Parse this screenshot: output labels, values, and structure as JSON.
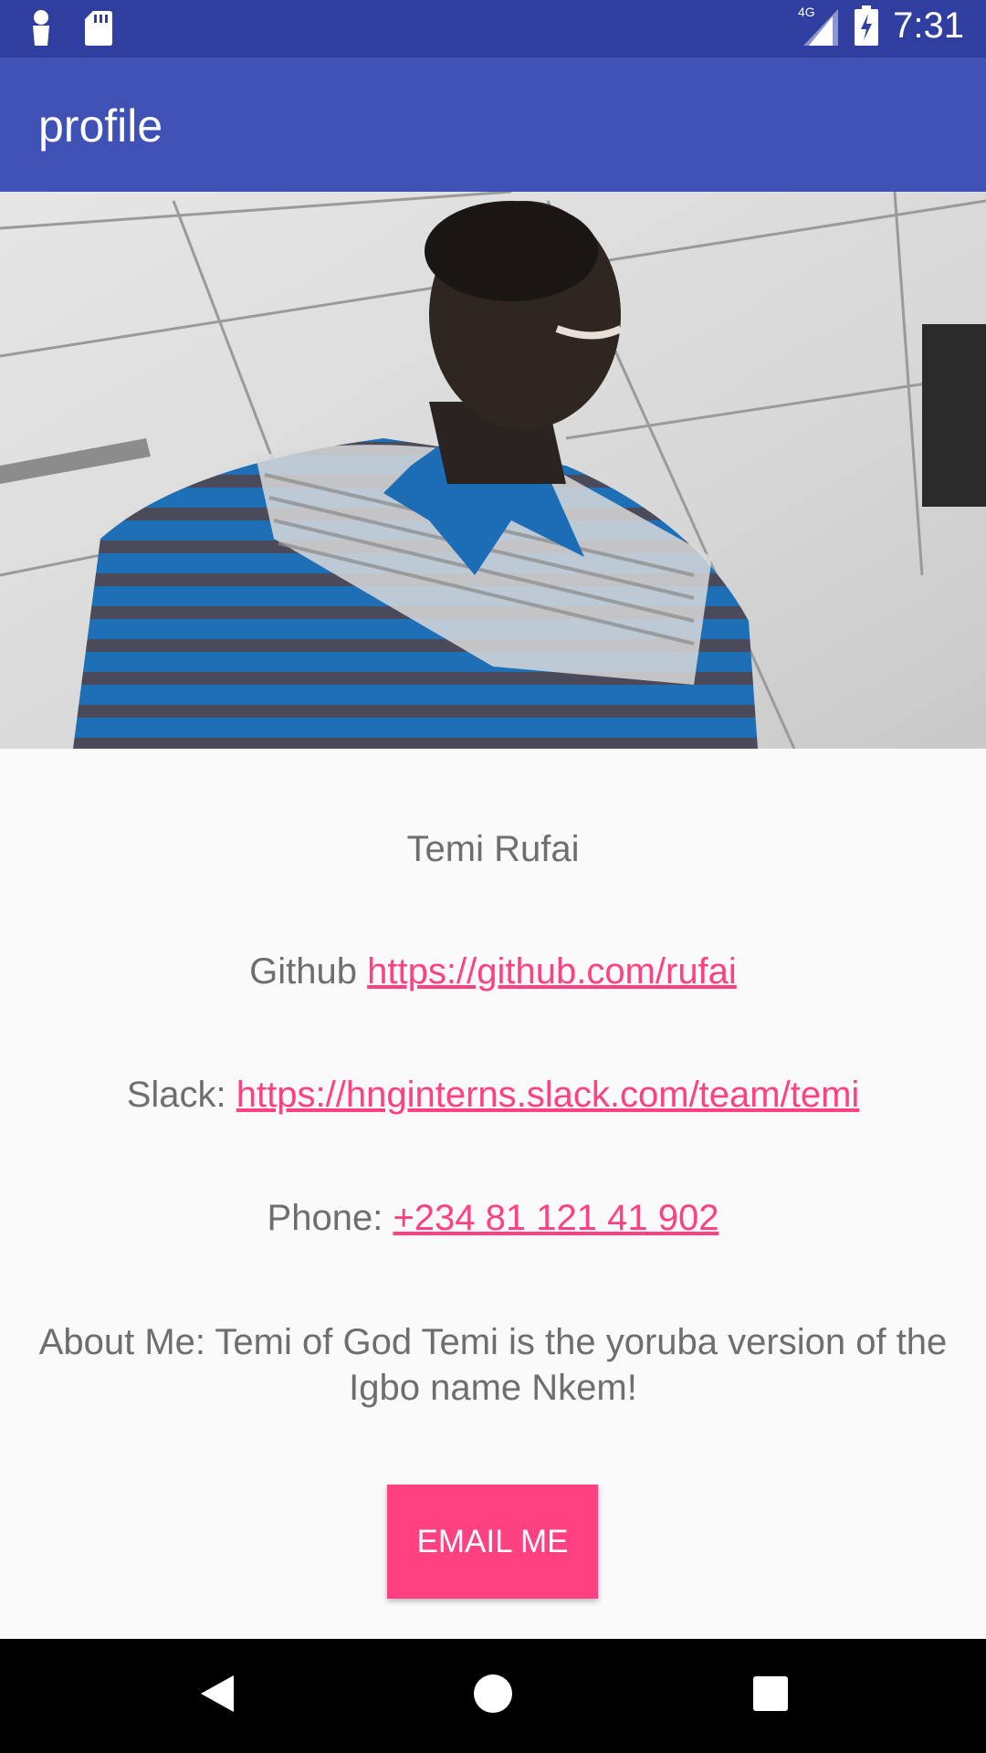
{
  "status_bar": {
    "time": "7:31",
    "network": "4G"
  },
  "app_bar": {
    "title": "profile"
  },
  "profile": {
    "name": "Temi Rufai",
    "github_label": "Github",
    "github_link": "https://github.com/rufai",
    "slack_label": "Slack:",
    "slack_link": "https://hnginterns.slack.com/team/temi",
    "phone_label": "Phone:",
    "phone_link": "+234 81 121 41 902",
    "about": "About Me: Temi of God Temi is the yoruba version of the Igbo name Nkem!"
  },
  "actions": {
    "email_button": "EMAIL ME"
  },
  "colors": {
    "status_bar": "#303f9f",
    "app_bar": "#3f51b5",
    "accent": "#ff4081",
    "body_text": "#6e6e6e"
  },
  "icons": [
    "notification-icon",
    "sd-card-icon",
    "cellular-signal-icon",
    "battery-charging-icon",
    "back-icon",
    "home-icon",
    "recents-icon"
  ]
}
